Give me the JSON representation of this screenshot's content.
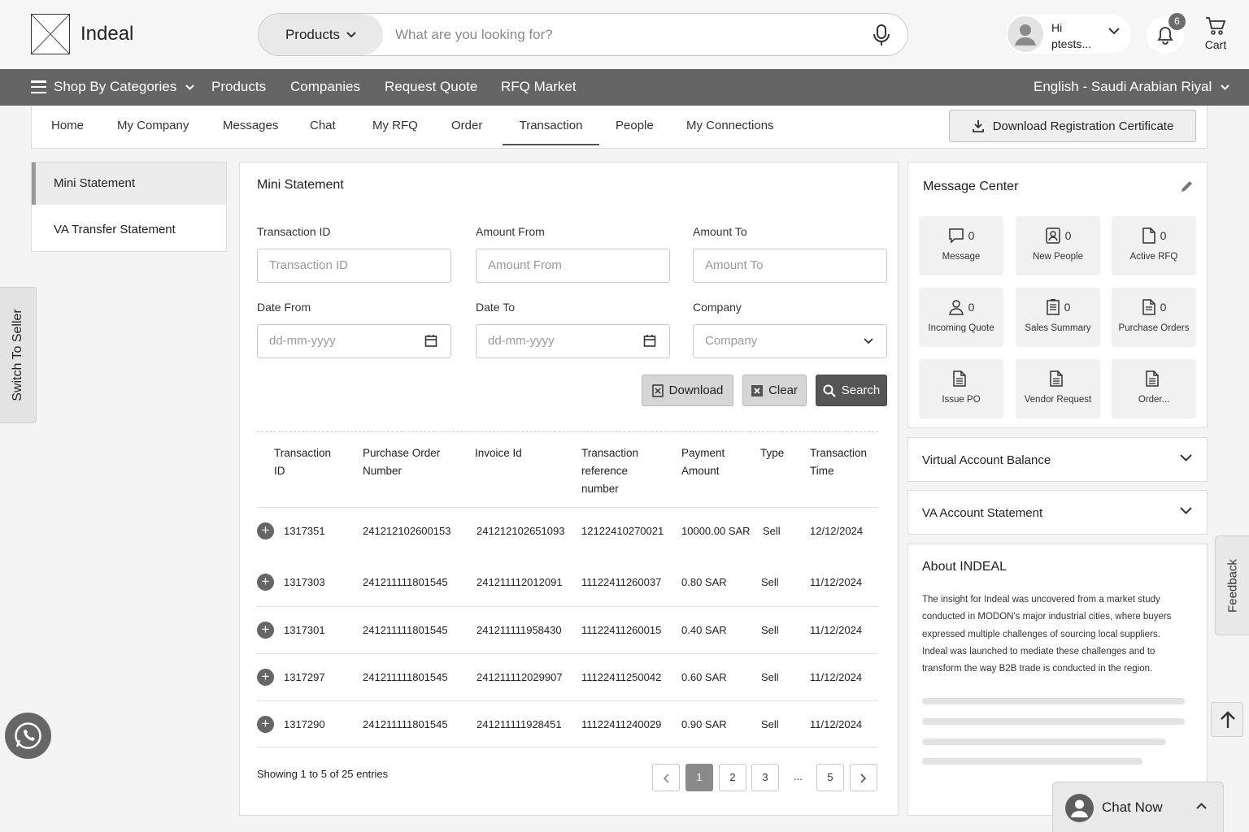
{
  "header": {
    "brand": "Indeal",
    "category_label": "Products",
    "search_placeholder": "What are you looking for?",
    "greeting": "Hi",
    "username": "ptests...",
    "notification_count": "6",
    "cart_label": "Cart"
  },
  "navbar": {
    "shop_by_categories": "Shop By Categories",
    "items": [
      "Products",
      "Companies",
      "Request Quote",
      "RFQ Market"
    ],
    "language_currency": "English - Saudi Arabian Riyal"
  },
  "tabs": {
    "items": [
      "Home",
      "My Company",
      "Messages",
      "Chat",
      "My RFQ",
      "Order",
      "Transaction",
      "People",
      "My Connections"
    ],
    "active": "Transaction",
    "download_certificate": "Download Registration Certificate"
  },
  "side_menu": {
    "items": [
      "Mini Statement",
      "VA Transfer Statement"
    ],
    "active": "Mini Statement"
  },
  "switch_to_seller": "Switch To Seller",
  "mini_statement": {
    "title": "Mini Statement",
    "filters": {
      "transaction_id_label": "Transaction ID",
      "transaction_id_placeholder": "Transaction ID",
      "amount_from_label": "Amount From",
      "amount_from_placeholder": "Amount From",
      "amount_to_label": "Amount To",
      "amount_to_placeholder": "Amount To",
      "date_from_label": "Date From",
      "date_from_placeholder": "dd-mm-yyyy",
      "date_to_label": "Date To",
      "date_to_placeholder": "dd-mm-yyyy",
      "company_label": "Company",
      "company_placeholder": "Company"
    },
    "buttons": {
      "download": "Download",
      "clear": "Clear",
      "search": "Search"
    },
    "columns": [
      [
        "Transaction",
        "ID"
      ],
      [
        "Purchase Order",
        "Number"
      ],
      [
        "Invoice Id"
      ],
      [
        "Transaction",
        "reference",
        "number"
      ],
      [
        "Payment",
        "Amount"
      ],
      [
        "Type"
      ],
      [
        "Transaction",
        "Time"
      ]
    ],
    "rows": [
      [
        "1317351",
        "241212102600153",
        "241212102651093",
        "12122410270021",
        "10000.00 SAR",
        "Sell",
        "12/12/2024"
      ],
      [
        "1317303",
        "241211111801545",
        "241211112012091",
        "11122411260037",
        "0.80 SAR",
        "Sell",
        "11/12/2024"
      ],
      [
        "1317301",
        "241211111801545",
        "241211111958430",
        "11122411260015",
        "0.40 SAR",
        "Sell",
        "11/12/2024"
      ],
      [
        "1317297",
        "241211111801545",
        "241211112029907",
        "11122411250042",
        "0.60 SAR",
        "Sell",
        "11/12/2024"
      ],
      [
        "1317290",
        "241211111801545",
        "241211111928451",
        "11122411240029",
        "0.90 SAR",
        "Sell",
        "11/12/2024"
      ]
    ],
    "showing": "Showing 1 to 5 of 25 entries",
    "pagination": {
      "pages": [
        "1",
        "2",
        "3",
        "...",
        "5"
      ],
      "active": "1"
    }
  },
  "message_center": {
    "title": "Message Center",
    "tiles": [
      {
        "label": "Message",
        "count": "0",
        "icon": "message-icon"
      },
      {
        "label": "New People",
        "count": "0",
        "icon": "person-card-icon"
      },
      {
        "label": "Active RFQ",
        "count": "0",
        "icon": "document-icon"
      },
      {
        "label": "Incoming Quote",
        "count": "0",
        "icon": "user-icon"
      },
      {
        "label": "Sales Summary",
        "count": "0",
        "icon": "clipboard-icon"
      },
      {
        "label": "Purchase Orders",
        "count": "0",
        "icon": "invoice-icon"
      },
      {
        "label": "Issue PO",
        "count": "",
        "icon": "document-lines-icon"
      },
      {
        "label": "Vendor Request",
        "count": "",
        "icon": "document-lines-icon"
      },
      {
        "label": "Order...",
        "count": "",
        "icon": "document-lines-icon"
      }
    ]
  },
  "virtual_account_balance": "Virtual Account Balance",
  "va_account_statement": "VA Account Statement",
  "about": {
    "title": "About INDEAL",
    "lines": [
      "The insight for Indeal was uncovered from a market study",
      "conducted in MODON's major industrial cities, where buyers",
      "expressed multiple challenges of sourcing local suppliers.",
      "Indeal was launched to mediate these challenges and to",
      "transform the way B2B trade is conducted in the region."
    ]
  },
  "feedback": "Feedback",
  "chat_now": "Chat Now",
  "colors": {
    "navbar": "#646464",
    "accent_dark": "#555555",
    "panel_bg": "#ffffff",
    "page_bg": "#f4f4f4"
  }
}
